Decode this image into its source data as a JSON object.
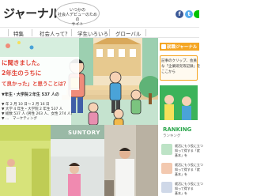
{
  "header": {
    "logo_text": "ジャーナル",
    "bubble_lines": [
      "いつかの",
      "社会人デビューのための",
      "サイト"
    ]
  },
  "nav": {
    "items": [
      "特集",
      "社会人って？",
      "学生いろいろ",
      "グローバル"
    ]
  },
  "hero": {
    "headline_lines": [
      "に聞きました。",
      "2年生のうちに",
      "て良かった」と思うことは？"
    ],
    "lead_lines": [
      "▼年生・大学院２年生 537 人の",
      "",
      "▼ 年 2 月 10 日～ 2 月 16 日",
      "▼ 大学 4 年生・大学院 2 年生 537 人",
      "▼ 総数 537 人 (男性 263 人、女性 274 人)",
      "▼ …　マーケティング"
    ]
  },
  "photos": {
    "sign_text": "SUNTORY"
  },
  "sidebar": {
    "feature_title": "就職ジャーナル",
    "feature_lines": [
      "記事のクリップ、会員",
      "な「企業研究等記録」を",
      "ここから"
    ],
    "ranking_title": "RANKING",
    "ranking_sub": "ランキング",
    "ranking_items": [
      [
        "就活にもう役に立つ",
        "知って得する「就",
        "基本」を"
      ],
      [
        "就活にもう役に立つ",
        "知って得する「就",
        "基本」を"
      ],
      [
        "就活にもう役に立つ",
        "知って得する",
        "基本」を"
      ]
    ]
  },
  "colors": {
    "accent_red": "#e2463a",
    "accent_orange": "#f5a623",
    "accent_green": "#2aa64b"
  }
}
